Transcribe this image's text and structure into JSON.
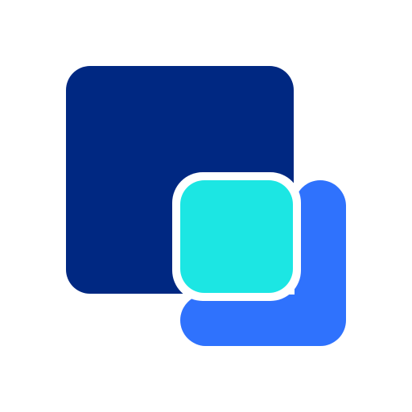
{
  "icon": {
    "name": "overlapping-squares-icon",
    "colors": {
      "background": "#ffffff",
      "large_square": "#002882",
      "corner_bracket": "#2f72fd",
      "small_square": "#1ce6e3",
      "gap": "#ffffff"
    }
  }
}
